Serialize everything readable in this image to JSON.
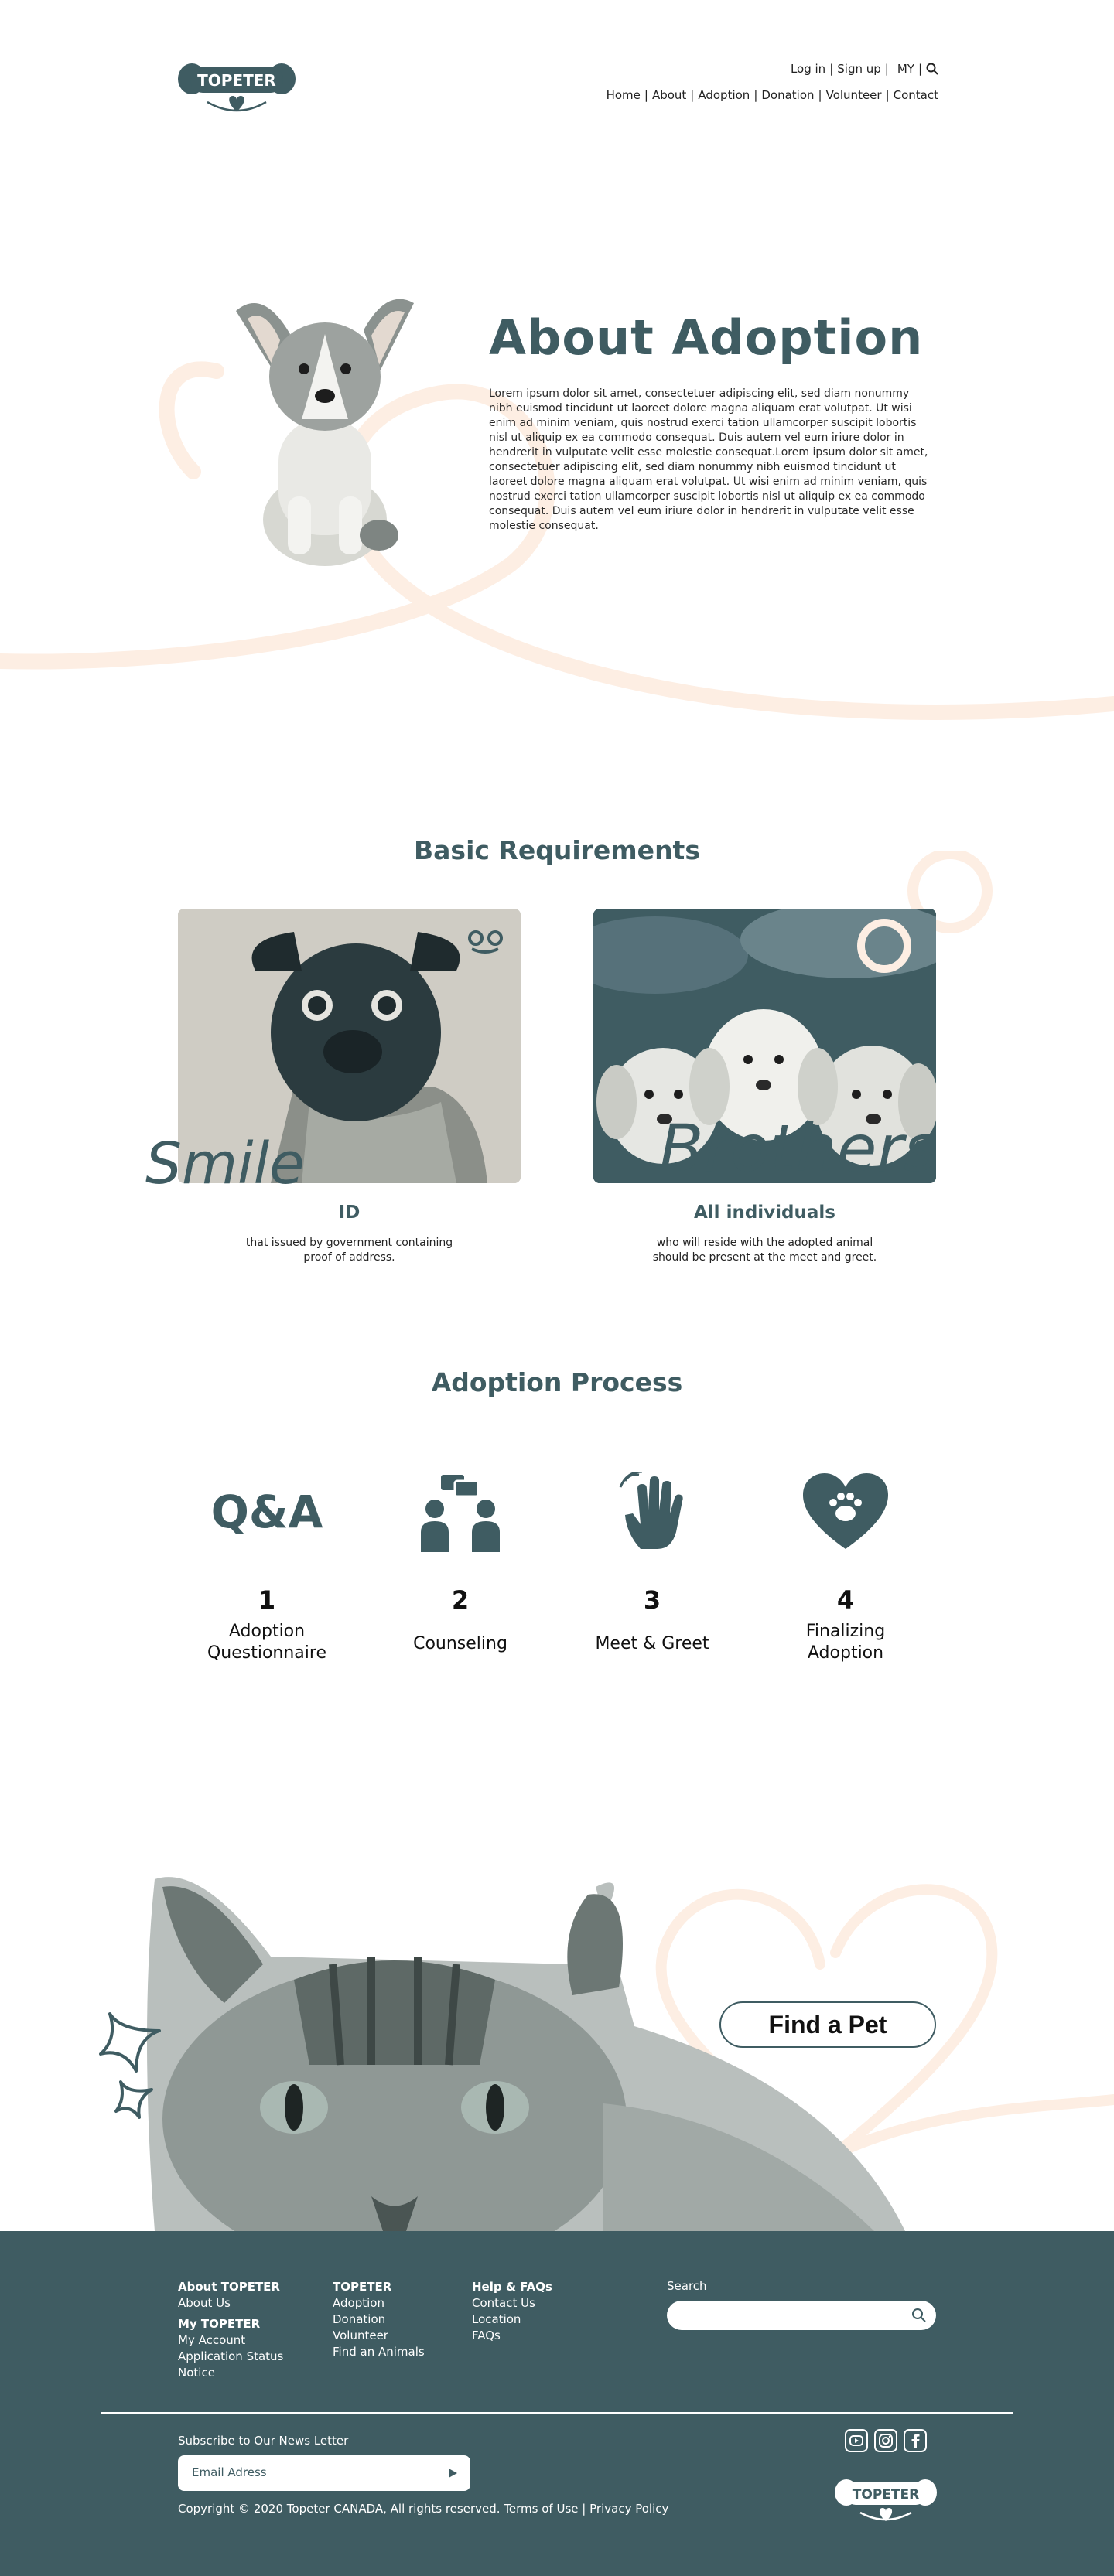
{
  "brand": {
    "name": "TOPETER",
    "primary": "#3f5c62",
    "accent": "#fdeee3"
  },
  "header": {
    "login": "Log in",
    "signup": "Sign up",
    "my": "MY",
    "search_icon": "search-icon",
    "nav": [
      "Home",
      "About",
      "Adoption",
      "Donation",
      "Volunteer",
      "Contact"
    ]
  },
  "hero": {
    "title": "About Adoption",
    "body": "Lorem ipsum dolor sit amet, consectetuer adipiscing elit, sed diam nonummy nibh euismod tincidunt ut laoreet dolore magna aliquam erat volutpat. Ut wisi enim ad minim veniam, quis nostrud exerci tation ullamcorper suscipit lobortis nisl ut aliquip ex ea commodo consequat. Duis autem vel eum iriure dolor in hendrerit in vulputate velit esse molestie consequat.Lorem ipsum dolor sit amet, consectetuer adipiscing elit, sed diam nonummy nibh euismod tincidunt ut laoreet dolore magna aliquam erat volutpat. Ut wisi enim ad minim veniam, quis nostrud exerci tation ullamcorper suscipit lobortis nisl ut aliquip ex ea commodo consequat. Duis autem vel eum iriure dolor in hendrerit in vulputate velit esse molestie consequat."
  },
  "requirements": {
    "title": "Basic Requirements",
    "cards": [
      {
        "script": "Smile",
        "caption": "ID",
        "desc_1": "that issued by government containing",
        "desc_2": "proof of address."
      },
      {
        "script": "Brothers",
        "caption": "All individuals",
        "desc_1": "who will reside with the adopted animal",
        "desc_2": "should be present at the meet and greet."
      }
    ]
  },
  "process": {
    "title": "Adoption Process",
    "qa_icon_text": "Q&A",
    "steps": [
      {
        "num": "1",
        "line1": "Adoption",
        "line2": "Questionnaire",
        "icon": "qa-icon"
      },
      {
        "num": "2",
        "line1": "Counseling",
        "line2": "",
        "icon": "conversation-icon"
      },
      {
        "num": "3",
        "line1": "Meet & Greet",
        "line2": "",
        "icon": "waving-hand-icon"
      },
      {
        "num": "4",
        "line1": "Finalizing",
        "line2": "Adoption",
        "icon": "heart-paw-icon"
      }
    ]
  },
  "cta": {
    "find_pet": "Find a Pet"
  },
  "footer": {
    "col1": {
      "h1": "About TOPETER",
      "a1": "About Us",
      "h2": "My TOPETER",
      "items": [
        "My Account",
        "Application Status",
        "Notice"
      ]
    },
    "col2": {
      "h": "TOPETER",
      "items": [
        "Adoption",
        "Donation",
        "Volunteer",
        "Find an Animals"
      ]
    },
    "col3": {
      "h": "Help & FAQs",
      "items": [
        "Contact Us",
        "Location",
        "FAQs"
      ]
    },
    "search_label": "Search",
    "subscribe_label": "Subscribe to Our News Letter",
    "email_placeholder": "Email Adress",
    "copyright": "Copyright © 2020 Topeter CANADA, All rights reserved.",
    "terms": "Terms of Use",
    "privacy": "Privacy Policy",
    "social": [
      "youtube-icon",
      "instagram-icon",
      "facebook-icon"
    ]
  }
}
